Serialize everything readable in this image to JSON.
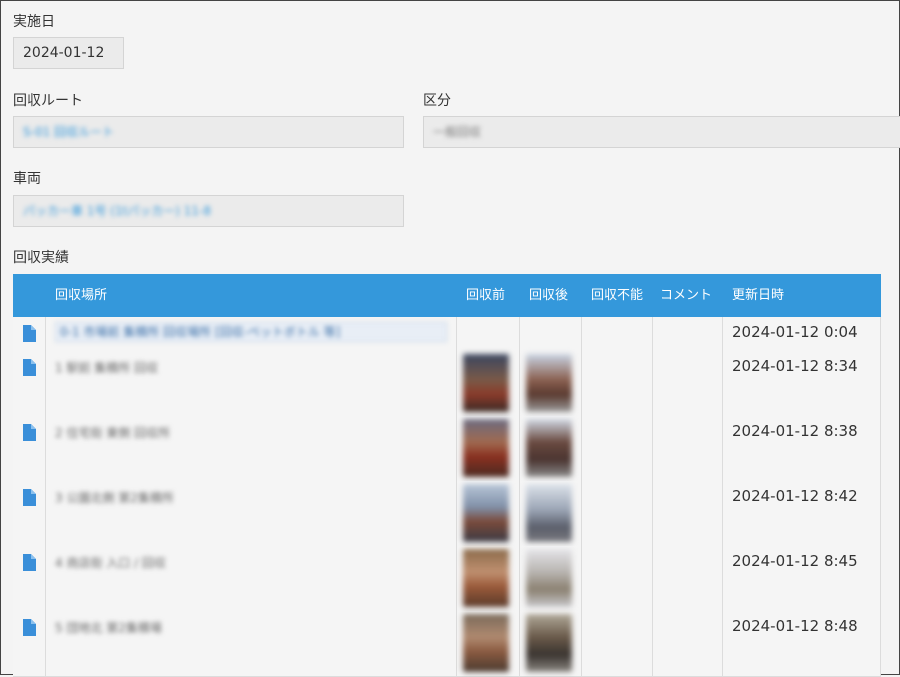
{
  "fields": {
    "date_label": "実施日",
    "date_value": "2024-01-12",
    "route_label": "回収ルート",
    "route_value": "S-01  回収ルート",
    "category_label": "区分",
    "category_value": "一般回収",
    "vehicle_label": "車両",
    "vehicle_value": "パッカー車 1号 (1tパッカー)  11-8"
  },
  "results": {
    "section_label": "回収実績",
    "headers": {
      "location": "回収場所",
      "before": "回収前",
      "after": "回収後",
      "impossible": "回収不能",
      "comment": "コメント",
      "updated": "更新日時"
    },
    "rows": [
      {
        "location": "0-1 市場前 集積所 回収場所 [回収-ペットボトル 等]",
        "updated": "2024-01-12 0:04",
        "photos": false
      },
      {
        "location": "1  駅前 集積所 回収",
        "updated": "2024-01-12 8:34",
        "photos": true
      },
      {
        "location": "2  住宅街 東側 回収所",
        "updated": "2024-01-12 8:38",
        "photos": true
      },
      {
        "location": "3  公園北側 第2集積所",
        "updated": "2024-01-12 8:42",
        "photos": true
      },
      {
        "location": "4  商店街 入口  /  回収",
        "updated": "2024-01-12 8:45",
        "photos": true
      },
      {
        "location": "5  団地北 第2集積場",
        "updated": "2024-01-12 8:48",
        "photos": true
      }
    ]
  },
  "colors": {
    "header_bg": "#3498db",
    "link": "#3498db"
  }
}
